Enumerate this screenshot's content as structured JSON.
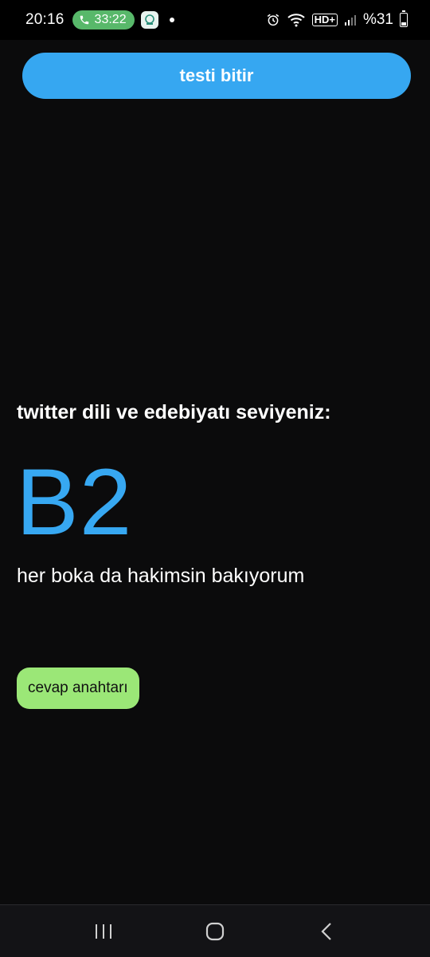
{
  "status_bar": {
    "time": "20:16",
    "call_duration": "33:22",
    "hd_label": "HD+",
    "battery_percent": "%31",
    "battery_level": 0.31,
    "icons": [
      "phone-icon",
      "app-notification-icon",
      "alarm-icon",
      "wifi-calling-icon",
      "hd-voice-icon",
      "signal-icon",
      "battery-icon"
    ]
  },
  "main": {
    "finish_button_label": "testi bitir",
    "level_label": "twitter dili ve edebiyatı seviyeniz:",
    "level_value": "B2",
    "level_comment": "her boka da hakimsin bakıyorum",
    "answer_key_button_label": "cevap anahtarı"
  },
  "colors": {
    "background": "#0b0b0c",
    "accent_blue": "#36a7f1",
    "answer_key_green": "#9be777",
    "call_pill_green": "#58b86a"
  },
  "nav_bar": {
    "icons": [
      "recent-apps-icon",
      "home-icon",
      "back-icon"
    ]
  }
}
